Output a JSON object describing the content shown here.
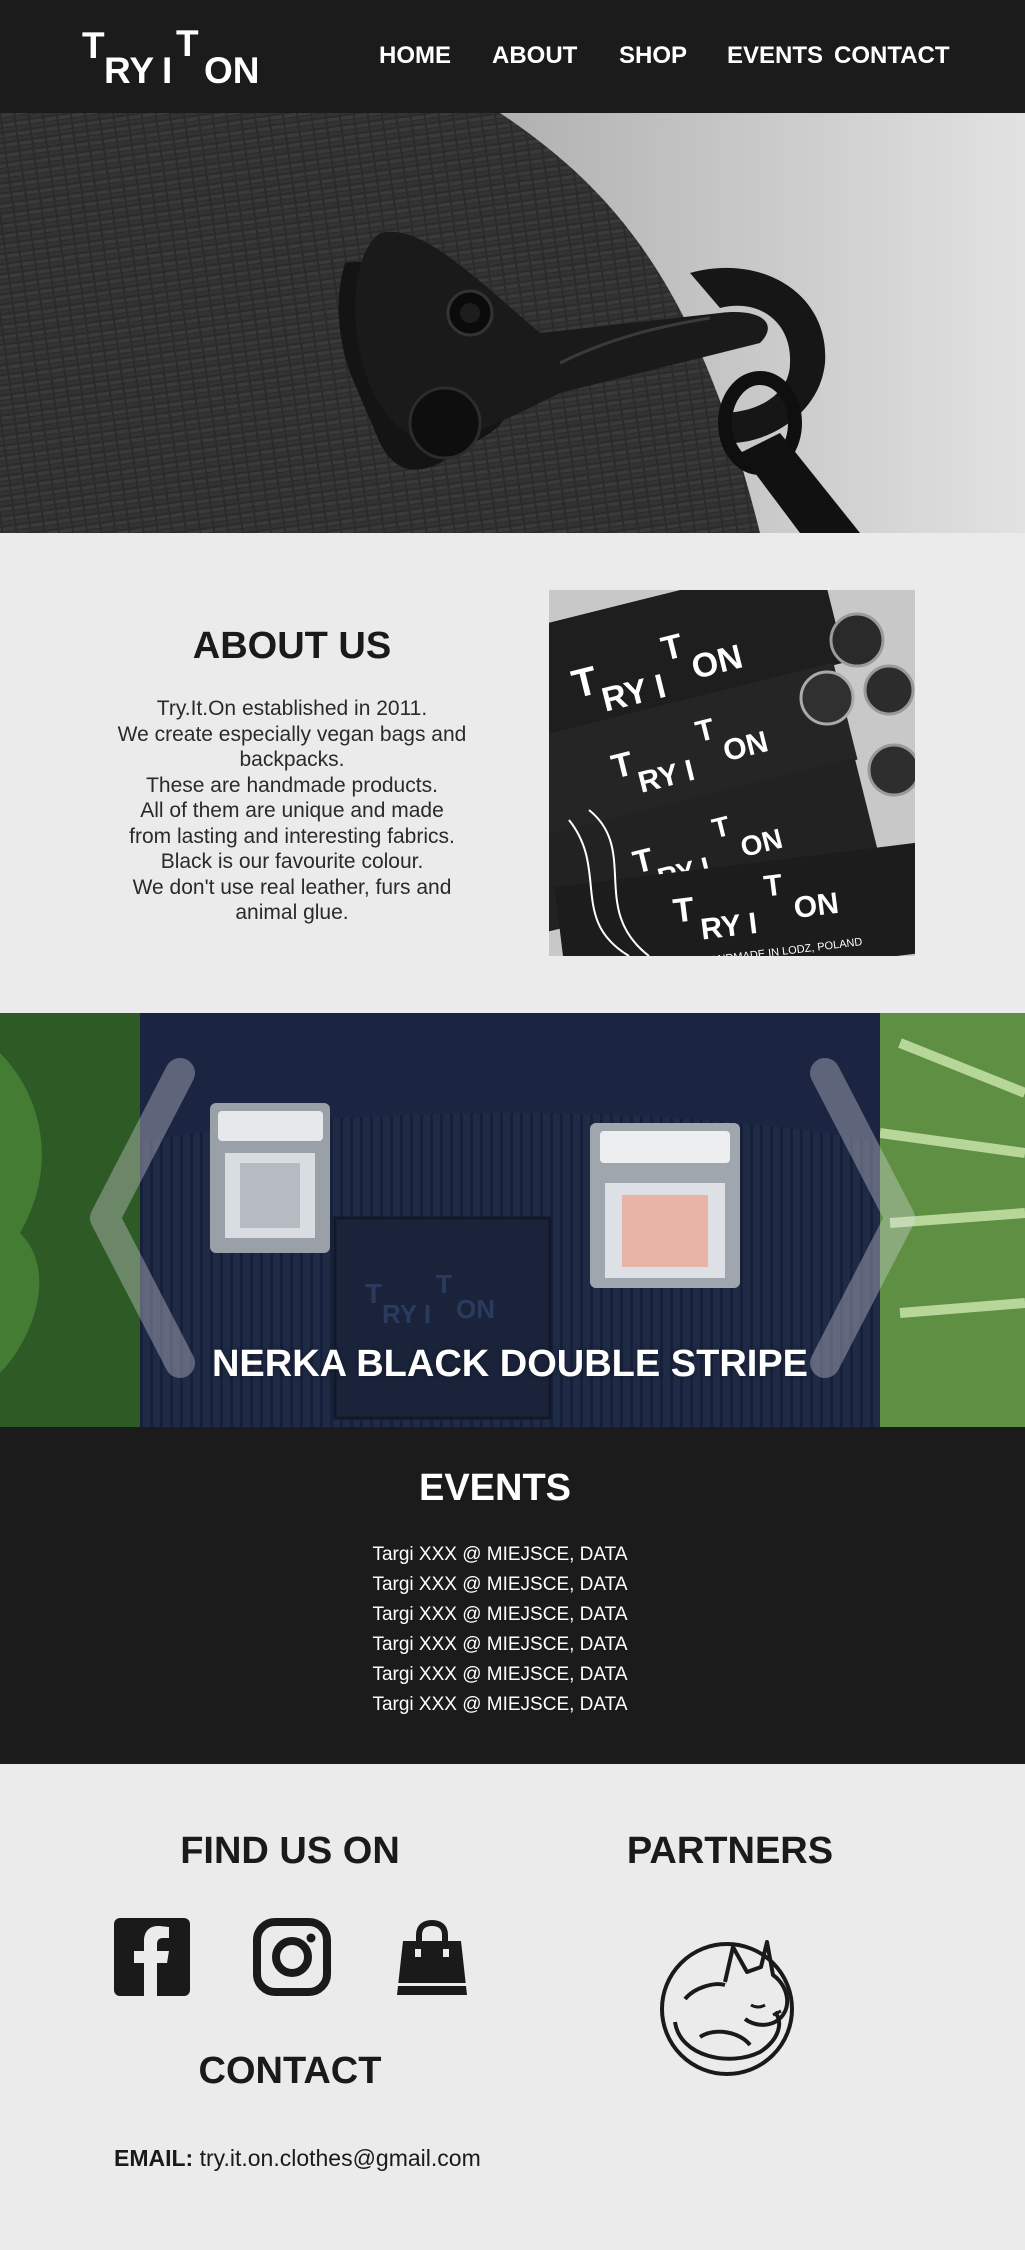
{
  "brand": {
    "logo_letters": [
      "T",
      "RY",
      "I",
      "T",
      "ON"
    ]
  },
  "nav": {
    "items": [
      "HOME",
      "ABOUT",
      "SHOP",
      "EVENTS",
      "CONTACT"
    ]
  },
  "about": {
    "title": "ABOUT US",
    "lines": [
      "Try.It.On established in 2011.",
      "We create especially vegan bags and",
      "backpacks.",
      "These are handmade products.",
      "All of them are unique and made",
      "from lasting and interesting fabrics.",
      "Black is our favourite colour.",
      "We don't use real leather, furs and",
      "animal glue."
    ],
    "image_caption": "HANDMADE IN LODZ, POLAND"
  },
  "slider": {
    "title": "NERKA BLACK DOUBLE STRIPE",
    "prev_icon": "chevron-left-icon",
    "next_icon": "chevron-right-icon"
  },
  "events": {
    "title": "EVENTS",
    "items": [
      "Targi XXX @ MIEJSCE, DATA",
      "Targi XXX @ MIEJSCE, DATA",
      "Targi XXX @ MIEJSCE, DATA",
      "Targi XXX @ MIEJSCE, DATA",
      "Targi XXX @ MIEJSCE, DATA",
      "Targi XXX @ MIEJSCE, DATA"
    ]
  },
  "footer": {
    "find_us_title": "FIND US ON",
    "partners_title": "PARTNERS",
    "contact_title": "CONTACT",
    "socials": [
      "facebook-icon",
      "instagram-icon",
      "shopping-bag-icon"
    ],
    "partner_icon": "fox-logo",
    "email_label": "EMAIL:",
    "email_value": "try.it.on.clothes@gmail.com"
  },
  "colors": {
    "dark": "#1b1b1b",
    "light": "#ecebeb",
    "text": "#1a1a1a",
    "white": "#ffffff"
  }
}
